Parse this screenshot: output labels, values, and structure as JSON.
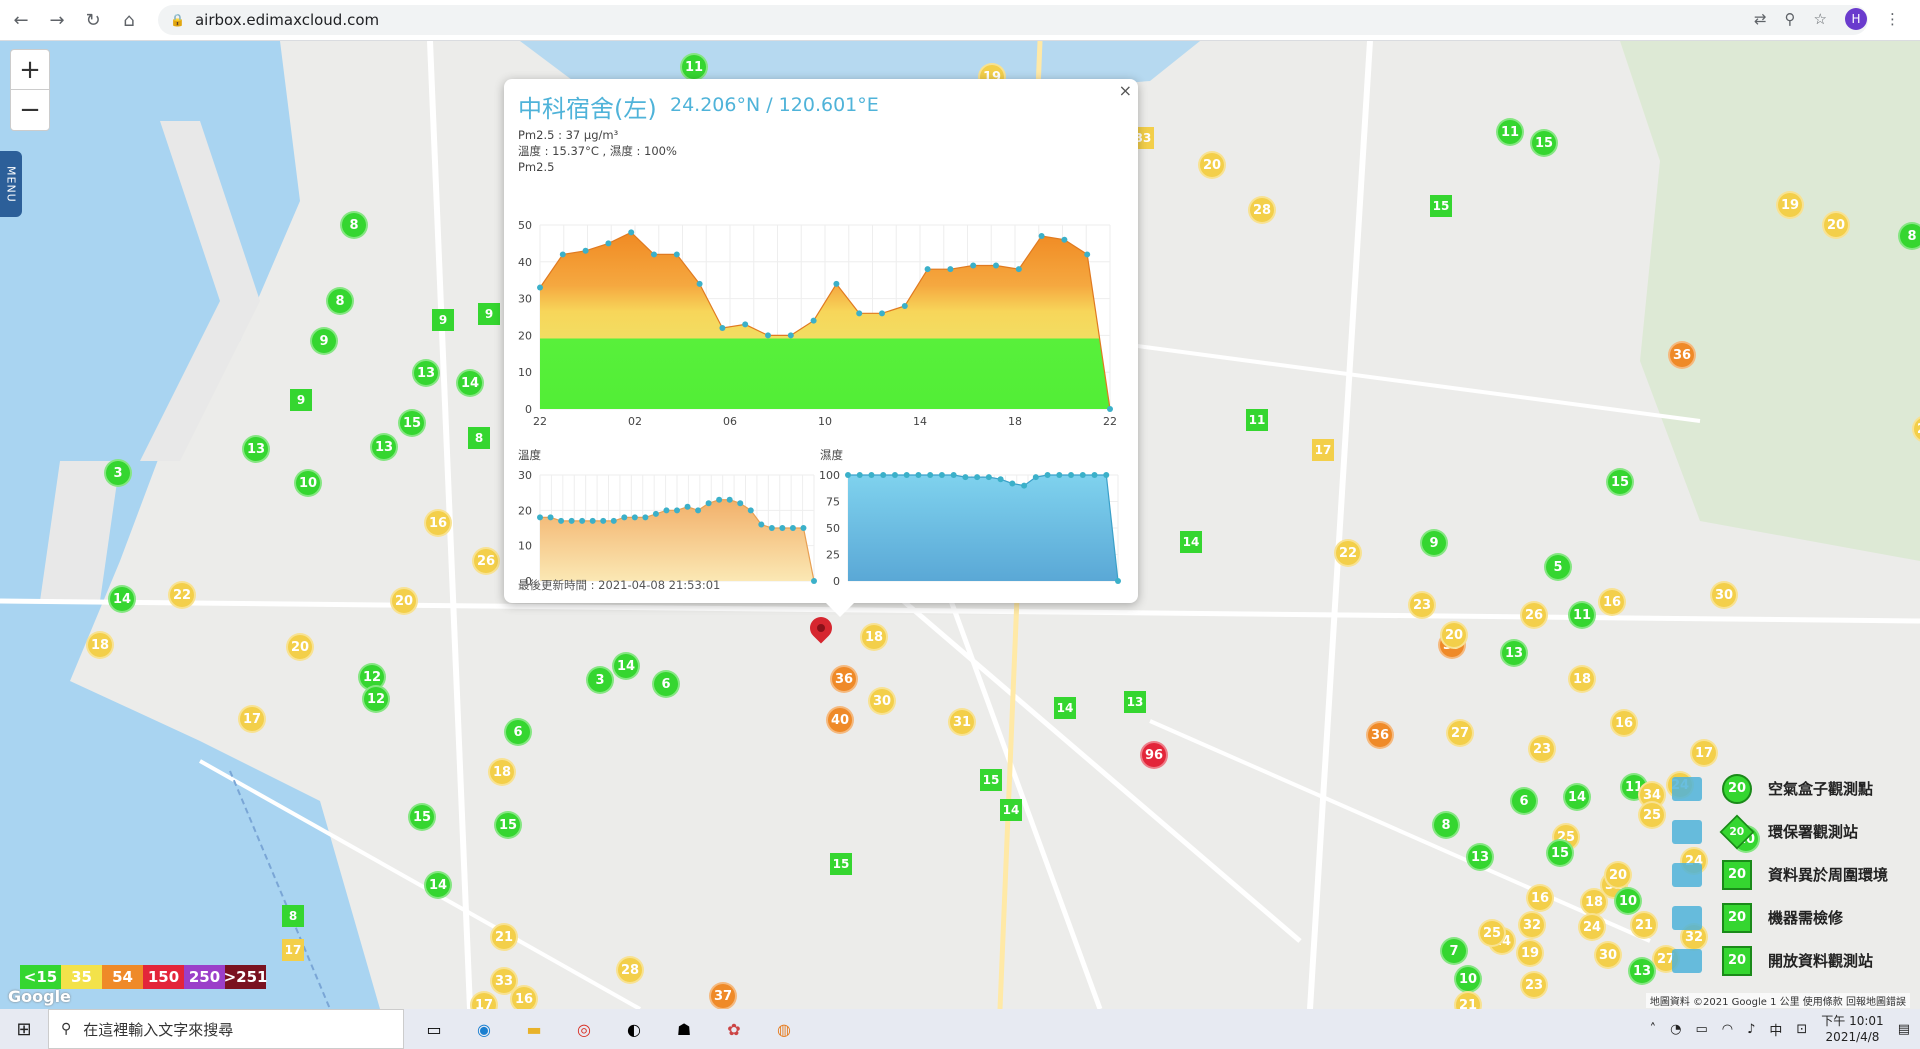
{
  "browser": {
    "url": "airbox.edimaxcloud.com",
    "avatar_letter": "H"
  },
  "map": {
    "zoom_in": "+",
    "zoom_out": "−",
    "menu": "MENU",
    "google": "Google",
    "attribution": "地圖資料 ©2021 Google  1 公里  使用條款  回報地圖錯誤"
  },
  "popup": {
    "title": "中科宿舍(左)",
    "coord": "24.206°N / 120.601°E",
    "pm_line": "Pm2.5 : 37 μg/m³",
    "temp_line": "溫度 : 15.37°C , 濕度 : 100%",
    "chart_title": "Pm2.5",
    "temp_title": "溫度",
    "humid_title": "濕度",
    "updated": "最後更新時間 : 2021-04-08 21:53:01",
    "close": "×"
  },
  "chart_data": [
    {
      "type": "area",
      "title": "Pm2.5",
      "x_ticks": [
        "22",
        "02",
        "06",
        "10",
        "14",
        "18",
        "22"
      ],
      "ylim": [
        0,
        50
      ],
      "y_ticks": [
        0,
        10,
        20,
        30,
        40,
        50
      ],
      "values": [
        33,
        42,
        43,
        45,
        48,
        42,
        42,
        34,
        22,
        23,
        20,
        20,
        24,
        34,
        26,
        26,
        28,
        38,
        38,
        39,
        39,
        38,
        47,
        46,
        42,
        0
      ]
    },
    {
      "type": "area",
      "title": "溫度",
      "ylim": [
        0,
        30
      ],
      "y_ticks": [
        0,
        10,
        20,
        30
      ],
      "values": [
        18,
        18,
        17,
        17,
        17,
        17,
        17,
        17,
        18,
        18,
        18,
        19,
        20,
        20,
        21,
        20,
        22,
        23,
        23,
        22,
        20,
        16,
        15,
        15,
        15,
        15,
        0
      ]
    },
    {
      "type": "area",
      "title": "濕度",
      "ylim": [
        0,
        100
      ],
      "y_ticks": [
        0,
        25,
        50,
        75,
        100
      ],
      "values": [
        100,
        100,
        100,
        100,
        100,
        100,
        100,
        100,
        100,
        100,
        98,
        98,
        98,
        96,
        92,
        90,
        98,
        100,
        100,
        100,
        100,
        100,
        100,
        0
      ]
    }
  ],
  "legend": [
    {
      "label": "空氣盒子觀測點",
      "badge": "20",
      "shape": "circle"
    },
    {
      "label": "環保署觀測站",
      "badge": "20",
      "shape": "diamond"
    },
    {
      "label": "資料異於周圍環境",
      "badge": "20",
      "shape": "square"
    },
    {
      "label": "機器需檢修",
      "badge": "20",
      "shape": "square"
    },
    {
      "label": "開放資料觀測站",
      "badge": "20",
      "shape": "square"
    }
  ],
  "scale": [
    {
      "label": "<15",
      "color": "#35d630"
    },
    {
      "label": "35",
      "color": "#f3e24a"
    },
    {
      "label": "54",
      "color": "#ef8a28"
    },
    {
      "label": "150",
      "color": "#e3253a"
    },
    {
      "label": "250",
      "color": "#9b3fc9"
    },
    {
      "label": ">251",
      "color": "#7a1220"
    }
  ],
  "markers": [
    {
      "v": "11",
      "c": "green"
    },
    {
      "v": "19",
      "c": "yellow"
    },
    {
      "v": "8",
      "c": "green"
    },
    {
      "v": "8",
      "c": "green"
    },
    {
      "v": "9",
      "c": "green"
    },
    {
      "v": "13",
      "c": "green"
    },
    {
      "v": "14",
      "c": "green"
    },
    {
      "v": "15",
      "c": "green"
    },
    {
      "v": "13",
      "c": "green"
    },
    {
      "v": "13",
      "c": "green"
    },
    {
      "v": "3",
      "c": "green"
    },
    {
      "v": "10",
      "c": "green"
    },
    {
      "v": "16",
      "c": "yellow"
    },
    {
      "v": "26",
      "c": "yellow"
    },
    {
      "v": "22",
      "c": "yellow"
    },
    {
      "v": "14",
      "c": "green"
    },
    {
      "v": "18",
      "c": "yellow"
    },
    {
      "v": "20",
      "c": "yellow"
    },
    {
      "v": "20",
      "c": "yellow"
    },
    {
      "v": "12",
      "c": "green"
    },
    {
      "v": "12",
      "c": "green"
    },
    {
      "v": "17",
      "c": "yellow"
    },
    {
      "v": "3",
      "c": "green"
    },
    {
      "v": "14",
      "c": "green"
    },
    {
      "v": "6",
      "c": "green"
    },
    {
      "v": "6",
      "c": "green"
    },
    {
      "v": "18",
      "c": "yellow"
    },
    {
      "v": "15",
      "c": "green"
    },
    {
      "v": "15",
      "c": "green"
    },
    {
      "v": "14",
      "c": "green"
    },
    {
      "v": "21",
      "c": "yellow"
    },
    {
      "v": "33",
      "c": "yellow"
    },
    {
      "v": "16",
      "c": "yellow"
    },
    {
      "v": "17",
      "c": "yellow"
    },
    {
      "v": "28",
      "c": "yellow"
    },
    {
      "v": "37",
      "c": "orange"
    },
    {
      "v": "36",
      "c": "orange"
    },
    {
      "v": "40",
      "c": "orange"
    },
    {
      "v": "30",
      "c": "yellow"
    },
    {
      "v": "18",
      "c": "yellow"
    },
    {
      "v": "31",
      "c": "yellow"
    },
    {
      "v": "96",
      "c": "red"
    },
    {
      "v": "36",
      "c": "orange"
    },
    {
      "v": "39",
      "c": "orange"
    },
    {
      "v": "20",
      "c": "yellow"
    },
    {
      "v": "28",
      "c": "yellow"
    },
    {
      "v": "11",
      "c": "green"
    },
    {
      "v": "15",
      "c": "green"
    },
    {
      "v": "19",
      "c": "yellow"
    },
    {
      "v": "20",
      "c": "yellow"
    },
    {
      "v": "8",
      "c": "green"
    },
    {
      "v": "24",
      "c": "yellow"
    },
    {
      "v": "36",
      "c": "orange"
    },
    {
      "v": "15",
      "c": "green"
    },
    {
      "v": "16",
      "c": "yellow"
    },
    {
      "v": "9",
      "c": "green"
    },
    {
      "v": "23",
      "c": "yellow"
    },
    {
      "v": "22",
      "c": "yellow"
    },
    {
      "v": "27",
      "c": "yellow"
    },
    {
      "v": "26",
      "c": "yellow"
    },
    {
      "v": "5",
      "c": "green"
    },
    {
      "v": "11",
      "c": "green"
    },
    {
      "v": "23",
      "c": "yellow"
    },
    {
      "v": "32",
      "c": "yellow"
    },
    {
      "v": "24",
      "c": "yellow"
    },
    {
      "v": "20",
      "c": "yellow"
    },
    {
      "v": "13",
      "c": "green"
    },
    {
      "v": "18",
      "c": "yellow"
    },
    {
      "v": "25",
      "c": "yellow"
    },
    {
      "v": "30",
      "c": "yellow"
    },
    {
      "v": "16",
      "c": "yellow"
    },
    {
      "v": "14",
      "c": "green"
    },
    {
      "v": "17",
      "c": "yellow"
    },
    {
      "v": "10",
      "c": "green"
    },
    {
      "v": "24",
      "c": "yellow"
    },
    {
      "v": "32",
      "c": "yellow"
    },
    {
      "v": "27",
      "c": "yellow"
    },
    {
      "v": "6",
      "c": "green"
    },
    {
      "v": "21",
      "c": "yellow"
    },
    {
      "v": "13",
      "c": "green"
    },
    {
      "v": "31",
      "c": "yellow"
    },
    {
      "v": "18",
      "c": "yellow"
    },
    {
      "v": "23",
      "c": "yellow"
    },
    {
      "v": "7",
      "c": "green"
    },
    {
      "v": "10",
      "c": "green"
    },
    {
      "v": "11",
      "c": "green"
    },
    {
      "v": "16",
      "c": "yellow"
    },
    {
      "v": "19",
      "c": "yellow"
    },
    {
      "v": "21",
      "c": "yellow"
    },
    {
      "v": "34",
      "c": "yellow"
    },
    {
      "v": "25",
      "c": "yellow"
    },
    {
      "v": "24",
      "c": "yellow"
    },
    {
      "v": "20",
      "c": "yellow"
    },
    {
      "v": "10",
      "c": "green"
    },
    {
      "v": "30",
      "c": "yellow"
    },
    {
      "v": "24",
      "c": "yellow"
    },
    {
      "v": "25",
      "c": "yellow"
    },
    {
      "v": "13",
      "c": "green"
    },
    {
      "v": "15",
      "c": "green"
    },
    {
      "v": "8",
      "c": "green"
    }
  ],
  "squares": [
    {
      "v": "9",
      "c": "green"
    },
    {
      "v": "9",
      "c": "green"
    },
    {
      "v": "9",
      "c": "green"
    },
    {
      "v": "8",
      "c": "green"
    },
    {
      "v": "33",
      "c": "yellow"
    },
    {
      "v": "15",
      "c": "green"
    },
    {
      "v": "11",
      "c": "green"
    },
    {
      "v": "17",
      "c": "yellow"
    },
    {
      "v": "14",
      "c": "green"
    },
    {
      "v": "13",
      "c": "green"
    },
    {
      "v": "15",
      "c": "green"
    },
    {
      "v": "14",
      "c": "green"
    },
    {
      "v": "15",
      "c": "green"
    },
    {
      "v": "8",
      "c": "green"
    },
    {
      "v": "17",
      "c": "yellow"
    },
    {
      "v": "14",
      "c": "green"
    }
  ],
  "taskbar": {
    "search_placeholder": "在這裡輸入文字來搜尋",
    "ime": "中",
    "time": "下午 10:01",
    "date": "2021/4/8"
  }
}
